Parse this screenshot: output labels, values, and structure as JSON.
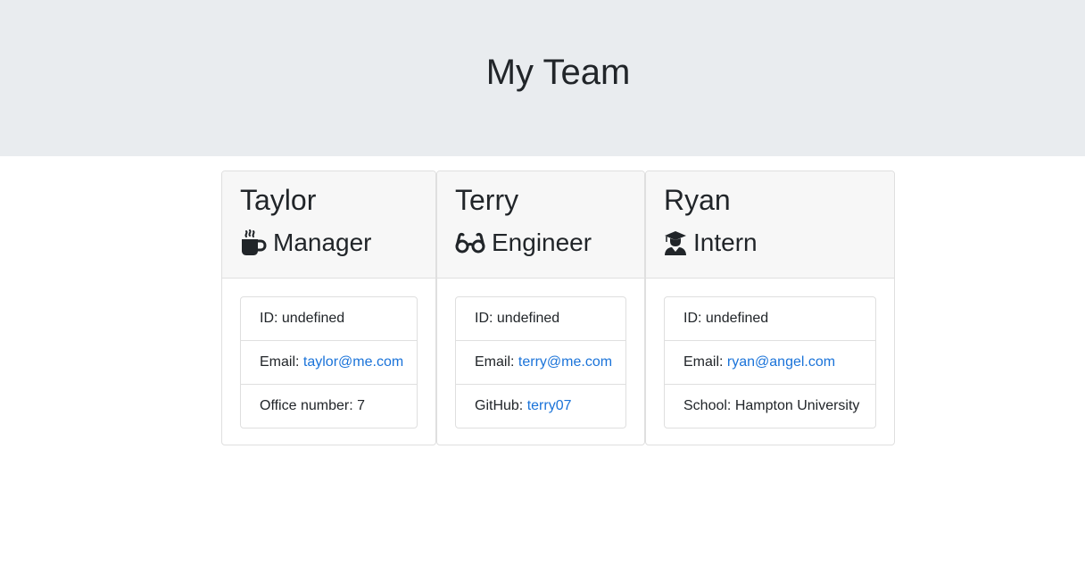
{
  "header": {
    "title": "My Team"
  },
  "cards": [
    {
      "name": "Taylor",
      "role": "Manager",
      "icon": "coffee-mug-icon",
      "id_label": "ID:",
      "id_value": "undefined",
      "email_label": "Email:",
      "email_value": "taylor@me.com",
      "extra_label": "Office number:",
      "extra_value": "7"
    },
    {
      "name": "Terry",
      "role": "Engineer",
      "icon": "glasses-icon",
      "id_label": "ID:",
      "id_value": "undefined",
      "email_label": "Email:",
      "email_value": "terry@me.com",
      "extra_label": "GitHub:",
      "extra_value": "terry07"
    },
    {
      "name": "Ryan",
      "role": "Intern",
      "icon": "graduate-icon",
      "id_label": "ID:",
      "id_value": "undefined",
      "email_label": "Email:",
      "email_value": "ryan@angel.com",
      "extra_label": "School:",
      "extra_value": "Hampton University"
    }
  ],
  "colors": {
    "jumbotron_bg": "#e9ecef",
    "card_header_bg": "#f7f7f7",
    "link": "#1a73d9",
    "text": "#212529",
    "border": "#dfdfdf"
  }
}
